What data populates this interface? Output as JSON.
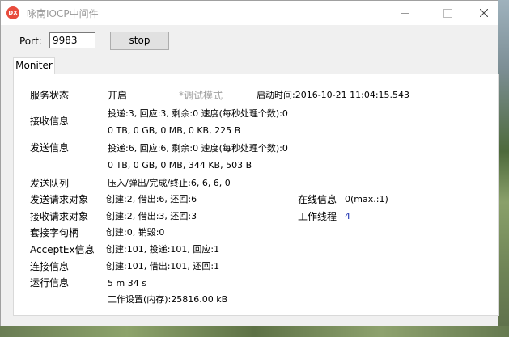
{
  "window": {
    "title": "咏南IOCP中间件",
    "icon_text": "DX",
    "minimize": "—",
    "maximize": "☐",
    "close": "✕"
  },
  "toolbar": {
    "port_label": "Port:",
    "port_value": "9983",
    "stop_label": "stop"
  },
  "tabs": [
    {
      "label": "Moniter"
    }
  ],
  "monitor": {
    "service_status_label": "服务状态",
    "service_status_value": "开启",
    "debug_mode": "*调试模式",
    "start_time": "启动时间:2016-10-21 11:04:15.543",
    "recv_info_label": "接收信息",
    "recv_info_line1": "投递:3, 回应:3, 剩余:0 速度(每秒处理个数):0",
    "recv_info_line2": "0 TB, 0 GB, 0 MB, 0 KB, 225 B",
    "send_info_label": "发送信息",
    "send_info_line1": "投递:6, 回应:6, 剩余:0 速度(每秒处理个数):0",
    "send_info_line2": "0 TB, 0 GB, 0 MB, 344 KB, 503 B",
    "send_queue_label": "发送队列",
    "send_queue_value": "压入/弹出/完成/终止:6, 6, 6, 0",
    "send_req_label": "发送请求对象",
    "send_req_value": "创建:2, 借出:6, 还回:6",
    "online_label": "在线信息",
    "online_value": "0(max.:1)",
    "recv_req_label": "接收请求对象",
    "recv_req_value": "创建:2, 借出:3, 还回:3",
    "worker_label": "工作线程",
    "worker_value": "4",
    "socket_label": "套接字句柄",
    "socket_value": "创建:0, 销毁:0",
    "acceptex_label": "AcceptEx信息",
    "acceptex_value": "创建:101, 投递:101, 回应:1",
    "conn_label": "连接信息",
    "conn_value": "创建:101, 借出:101, 还回:1",
    "run_label": "运行信息",
    "run_value": "5 m 34 s",
    "workset_value": "工作设置(内存):25816.00 kB"
  }
}
